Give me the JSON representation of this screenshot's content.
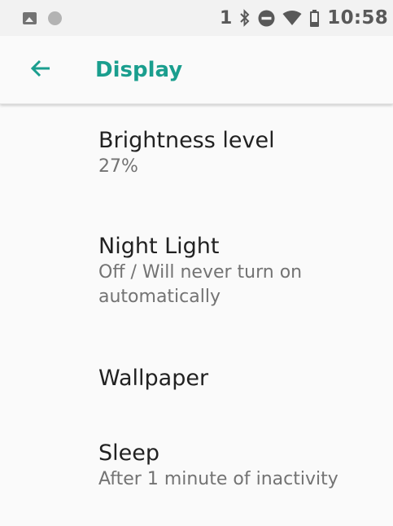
{
  "status_bar": {
    "sim_slot": "1",
    "time": "10:58",
    "icons": [
      "image-notification-icon",
      "circle-notification-icon",
      "bluetooth-icon",
      "do-not-disturb-icon",
      "wifi-icon",
      "battery-icon"
    ]
  },
  "app_bar": {
    "back_icon": "arrow-back-icon",
    "title": "Display",
    "accent_color": "#1a9e8e"
  },
  "preferences": [
    {
      "title": "Brightness level",
      "summary": "27%"
    },
    {
      "title": "Night Light",
      "summary": "Off / Will never turn on automatically"
    },
    {
      "title": "Wallpaper",
      "summary": ""
    },
    {
      "title": "Sleep",
      "summary": "After 1 minute of inactivity"
    }
  ]
}
